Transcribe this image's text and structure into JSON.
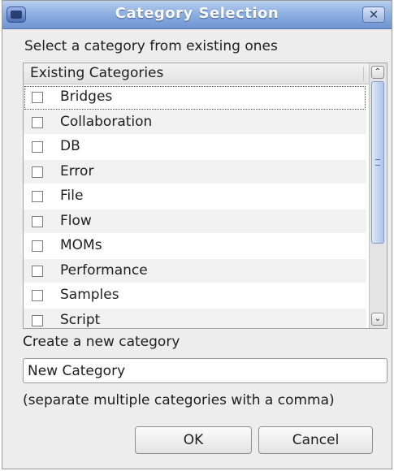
{
  "window": {
    "title": "Category Selection",
    "close_glyph": "✕"
  },
  "prompt": "Select a category from existing ones",
  "list": {
    "header": "Existing Categories",
    "items": [
      {
        "label": "Bridges",
        "checked": false
      },
      {
        "label": "Collaboration",
        "checked": false
      },
      {
        "label": "DB",
        "checked": false
      },
      {
        "label": "Error",
        "checked": false
      },
      {
        "label": "File",
        "checked": false
      },
      {
        "label": "Flow",
        "checked": false
      },
      {
        "label": "MOMs",
        "checked": false
      },
      {
        "label": "Performance",
        "checked": false
      },
      {
        "label": "Samples",
        "checked": false
      },
      {
        "label": "Script",
        "checked": false
      }
    ],
    "scroll_up_glyph": "⌃",
    "scroll_down_glyph": "⌄"
  },
  "new_category": {
    "label": "Create a new category",
    "value": "New Category",
    "hint": "(separate multiple categories with a comma)"
  },
  "buttons": {
    "ok": "OK",
    "cancel": "Cancel"
  },
  "colors": {
    "titlebar": "#8fb0e2",
    "dialog_bg": "#ededed",
    "scroll_thumb": "#aec4ea"
  }
}
